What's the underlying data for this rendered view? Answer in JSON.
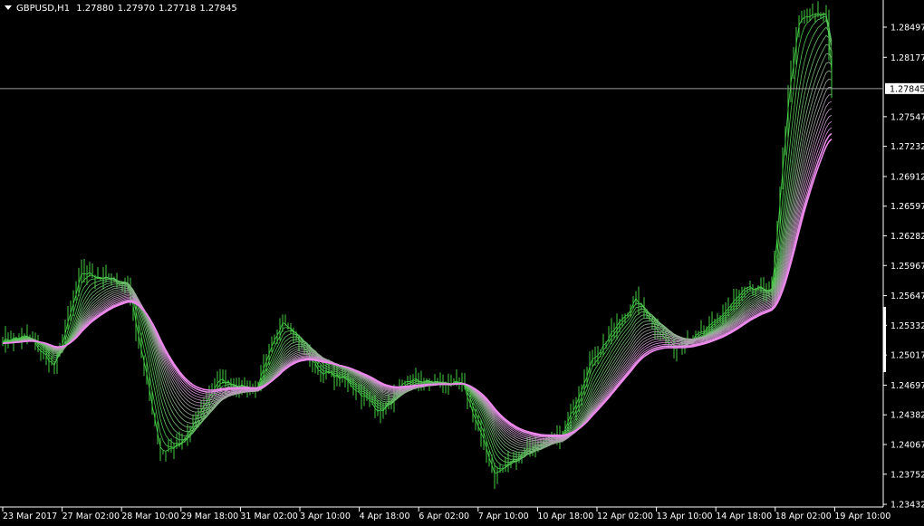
{
  "header": {
    "symbol": "GBPUSD,H1",
    "open": "1.27880",
    "high": "1.27970",
    "low": "1.27718",
    "close": "1.27845"
  },
  "colors": {
    "background": "#000000",
    "candles": "#44cc44",
    "ma_fast": "#44cc44",
    "ma_slow": "#ee88ee",
    "axis": "#ffffff"
  },
  "chart_data": {
    "type": "line",
    "description_type": "candlestick with moving-average ribbon",
    "ylim": [
      1.23432,
      1.2884
    ],
    "y_ticks": [
      "1.28497",
      "1.28177",
      "1.27547",
      "1.27232",
      "1.26912",
      "1.26597",
      "1.26282",
      "1.25967",
      "1.25647",
      "1.25332",
      "1.25017",
      "1.24697",
      "1.24382",
      "1.24067",
      "1.23752",
      "1.23432"
    ],
    "current_price": "1.27845",
    "x_ticks": [
      "23 Mar 2017",
      "27 Mar 02:00",
      "28 Mar 10:00",
      "29 Mar 18:00",
      "31 Mar 02:00",
      "3 Apr 10:00",
      "4 Apr 18:00",
      "6 Apr 02:00",
      "7 Apr 10:00",
      "10 Apr 18:00",
      "12 Apr 02:00",
      "13 Apr 10:00",
      "14 Apr 18:00",
      "18 Apr 02:00",
      "19 Apr 10:00"
    ],
    "close_keypoints": [
      [
        0,
        1.2518
      ],
      [
        9,
        1.2521
      ],
      [
        19,
        1.2489
      ],
      [
        29,
        1.259
      ],
      [
        46,
        1.2576
      ],
      [
        58,
        1.2398
      ],
      [
        66,
        1.2408
      ],
      [
        79,
        1.2475
      ],
      [
        93,
        1.2465
      ],
      [
        103,
        1.2542
      ],
      [
        116,
        1.2485
      ],
      [
        126,
        1.2475
      ],
      [
        139,
        1.2441
      ],
      [
        149,
        1.2475
      ],
      [
        169,
        1.247
      ],
      [
        181,
        1.2374
      ],
      [
        193,
        1.2403
      ],
      [
        206,
        1.2417
      ],
      [
        216,
        1.2494
      ],
      [
        233,
        1.2561
      ],
      [
        246,
        1.2508
      ],
      [
        259,
        1.2528
      ],
      [
        273,
        1.2571
      ],
      [
        283,
        1.2571
      ],
      [
        289,
        1.2782
      ],
      [
        293,
        1.2859
      ],
      [
        303,
        1.2864
      ],
      [
        305,
        1.2787
      ]
    ]
  }
}
